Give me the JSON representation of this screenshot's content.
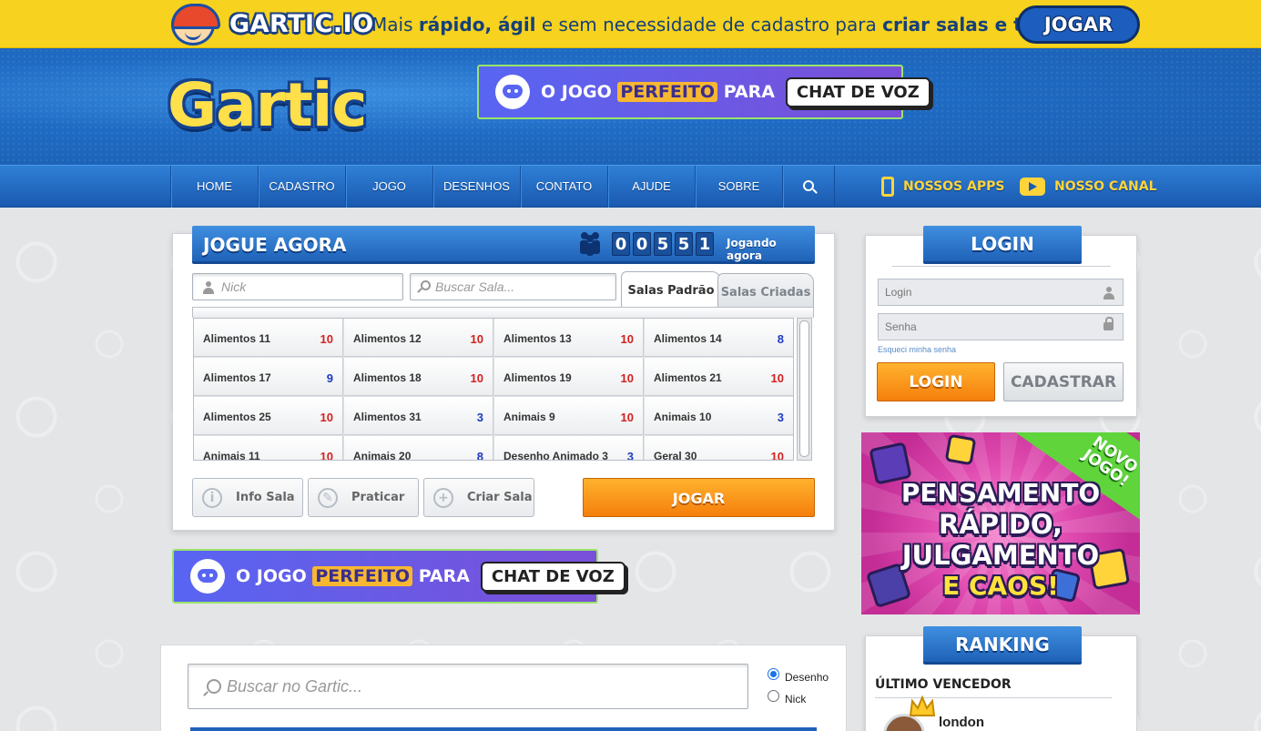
{
  "promo_bar": {
    "brand": "GARTIC.IO",
    "text_parts": [
      "Mais ",
      "rápido, ágil",
      " e sem necessidade de cadastro para ",
      "criar salas e temas."
    ],
    "button": "JOGAR"
  },
  "header": {
    "logo": "Gartic",
    "ad": {
      "part1": "O JOGO",
      "highlight": "PERFEITO",
      "part2": "PARA",
      "chip": "CHAT DE VOZ"
    }
  },
  "nav": {
    "items": [
      "HOME",
      "CADASTRO",
      "JOGO",
      "DESENHOS",
      "CONTATO",
      "AJUDE",
      "SOBRE"
    ],
    "search_icon": "search-icon",
    "apps": "NOSSOS APPS",
    "channel": "NOSSO CANAL"
  },
  "play_panel": {
    "title": "JOGUE AGORA",
    "counter": [
      "0",
      "0",
      "5",
      "5",
      "1"
    ],
    "counter_label": "Jogando agora",
    "nick_placeholder": "Nick",
    "search_placeholder": "Buscar Sala...",
    "tabs": [
      "Salas Padrão",
      "Salas Criadas"
    ],
    "rooms": [
      {
        "name": "Alimentos 11",
        "count": "10",
        "full": true
      },
      {
        "name": "Alimentos 12",
        "count": "10",
        "full": true
      },
      {
        "name": "Alimentos 13",
        "count": "10",
        "full": true
      },
      {
        "name": "Alimentos 14",
        "count": "8",
        "full": false
      },
      {
        "name": "Alimentos 17",
        "count": "9",
        "full": false
      },
      {
        "name": "Alimentos 18",
        "count": "10",
        "full": true
      },
      {
        "name": "Alimentos 19",
        "count": "10",
        "full": true
      },
      {
        "name": "Alimentos 21",
        "count": "10",
        "full": true
      },
      {
        "name": "Alimentos 25",
        "count": "10",
        "full": true
      },
      {
        "name": "Alimentos 31",
        "count": "3",
        "full": false
      },
      {
        "name": "Animais 9",
        "count": "10",
        "full": true
      },
      {
        "name": "Animais 10",
        "count": "3",
        "full": false
      },
      {
        "name": "Animais 11",
        "count": "10",
        "full": true
      },
      {
        "name": "Animais 20",
        "count": "8",
        "full": false
      },
      {
        "name": "Desenho Animado 3",
        "count": "3",
        "full": false
      },
      {
        "name": "Geral 30",
        "count": "10",
        "full": true
      }
    ],
    "buttons": {
      "info": "Info Sala",
      "practice": "Praticar",
      "create": "Criar Sala",
      "play": "JOGAR"
    }
  },
  "login": {
    "title": "LOGIN",
    "login_placeholder": "Login",
    "password_placeholder": "Senha",
    "forgot": "Esqueci minha senha",
    "login_button": "LOGIN",
    "register_button": "CADASTRAR"
  },
  "side_promo": {
    "corner": [
      "NOVO",
      "JOGO!"
    ],
    "lines": [
      "PENSAMENTO",
      "RÁPIDO, JULGAMENTO",
      "E CAOS!"
    ]
  },
  "ranking": {
    "title": "RANKING",
    "last_winner_label": "ÚLTIMO VENCEDOR",
    "winner": "london"
  },
  "site_search": {
    "placeholder": "Buscar no Gartic...",
    "options": [
      "Desenho",
      "Nick"
    ],
    "selected": "Desenho"
  },
  "colors": {
    "full_count": "#d42020",
    "open_count": "#1c3ac4",
    "primary_blue": "#1f62b8",
    "orange": "#f57f0c"
  }
}
